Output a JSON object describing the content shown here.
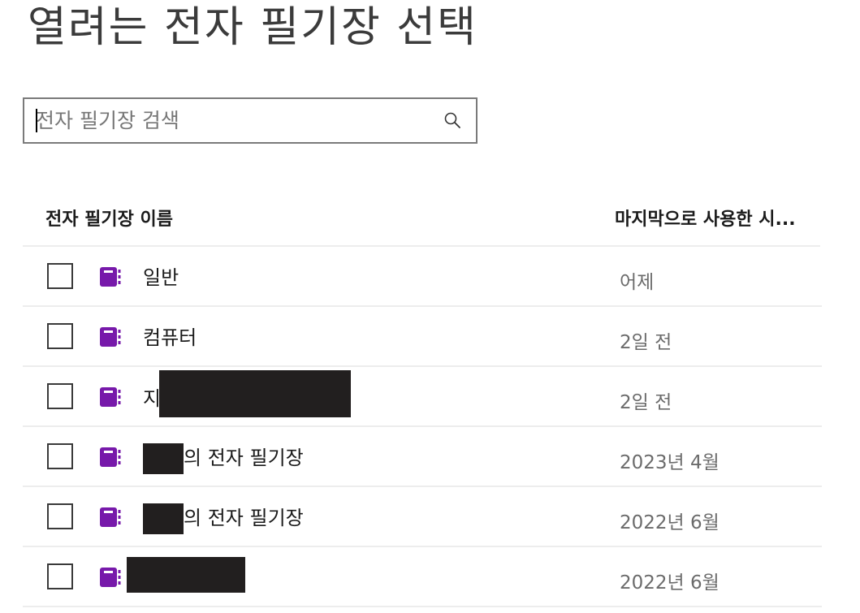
{
  "page": {
    "title": "열려는 전자 필기장 선택"
  },
  "search": {
    "placeholder": "전자 필기장 검색",
    "value": "",
    "icon": "search-icon"
  },
  "table": {
    "columns": {
      "name": "전자 필기장 이름",
      "last_used": "마지막으로 사용한 시..."
    },
    "rows": [
      {
        "prefix": "일반",
        "suffix": "",
        "date": "어제",
        "icon": "notebook-icon",
        "checked": false
      },
      {
        "prefix": "컴퓨터",
        "suffix": "",
        "date": "2일 전",
        "icon": "notebook-icon",
        "checked": false
      },
      {
        "prefix": "지",
        "suffix": "",
        "date": "2일 전",
        "icon": "notebook-icon",
        "checked": false
      },
      {
        "prefix": "",
        "suffix": "의 전자 필기장",
        "date": "2023년 4월",
        "icon": "notebook-icon",
        "checked": false
      },
      {
        "prefix": "",
        "suffix": "의 전자 필기장",
        "date": "2022년 6월",
        "icon": "notebook-icon",
        "checked": false
      },
      {
        "prefix": "",
        "suffix": "",
        "date": "2022년 6월",
        "icon": "notebook-icon",
        "checked": false
      }
    ]
  },
  "colors": {
    "notebook_accent": "#7719aa",
    "redaction": "#221f1f",
    "secondary_text": "#6b6b6b",
    "divider": "#ededed"
  }
}
